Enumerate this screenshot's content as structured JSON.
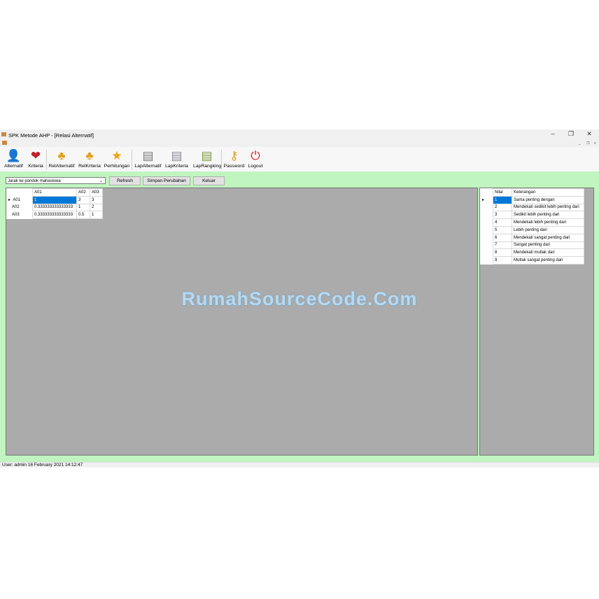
{
  "window": {
    "title": "SPK Metode AHP - [Relasi Alternatif]",
    "minimize": "–",
    "restore": "❐",
    "close": "✕",
    "mdi_min": "_",
    "mdi_restore": "❐",
    "mdi_close": "x"
  },
  "toolbar": [
    {
      "label": "Alternatif",
      "icon": "user-icon",
      "glyph": "👤",
      "color": "#2a7fd4"
    },
    {
      "label": "Kriteria",
      "icon": "heart-plus-icon",
      "glyph": "❤",
      "color": "#c0202a"
    },
    {
      "label": "RelAlternatif",
      "icon": "hierarchy-icon",
      "glyph": "♣",
      "color": "#e0a020"
    },
    {
      "label": "RelKriteria",
      "icon": "hierarchy-icon",
      "glyph": "♣",
      "color": "#e0a020"
    },
    {
      "label": "Perhitungan",
      "icon": "star-icon",
      "glyph": "★",
      "color": "#f0a010"
    },
    {
      "label": "LapAlternatif",
      "icon": "report-icon",
      "glyph": "▤",
      "color": "#777"
    },
    {
      "label": "LapKriteria",
      "icon": "report-icon",
      "glyph": "▤",
      "color": "#889"
    },
    {
      "label": "LapRangking",
      "icon": "chart-report-icon",
      "glyph": "▤",
      "color": "#7a9a40"
    },
    {
      "label": "Password",
      "icon": "key-icon",
      "glyph": "⚷",
      "color": "#e0a020"
    },
    {
      "label": "Logout",
      "icon": "power-icon",
      "glyph": "⏻",
      "color": "#e02020"
    }
  ],
  "form": {
    "criteria_select": "Jarak ke pondok mahasiswa",
    "refresh": "Refresh",
    "save": "Simpan Perubahan",
    "exit": "Keluar"
  },
  "matrix": {
    "headers": [
      "A01",
      "A02",
      "A03"
    ],
    "rows": [
      {
        "label": "A01",
        "cells": [
          "1",
          "3",
          "3"
        ]
      },
      {
        "label": "A02",
        "cells": [
          "0.333333333333333",
          "1",
          "2"
        ]
      },
      {
        "label": "A03",
        "cells": [
          "0.333333333333333",
          "0.5",
          "1"
        ]
      }
    ]
  },
  "scale": {
    "headers": [
      "Nilai",
      "Keterangan"
    ],
    "rows": [
      [
        "1",
        "Sama penting dengan"
      ],
      [
        "2",
        "Mendekati sedikit lebih penting dari"
      ],
      [
        "3",
        "Sedikit lebih penting dari"
      ],
      [
        "4",
        "Mendekati lebih penting dari"
      ],
      [
        "5",
        "Lebih penting dari"
      ],
      [
        "6",
        "Mendekati sangat penting dari"
      ],
      [
        "7",
        "Sangat penting dari"
      ],
      [
        "8",
        "Mendekati mutlak dari"
      ],
      [
        "9",
        "Mutlak sangat penting dari"
      ]
    ]
  },
  "watermark": "RumahSourceCode.Com",
  "status": "User: admin  16 February 2021 14:12:47"
}
